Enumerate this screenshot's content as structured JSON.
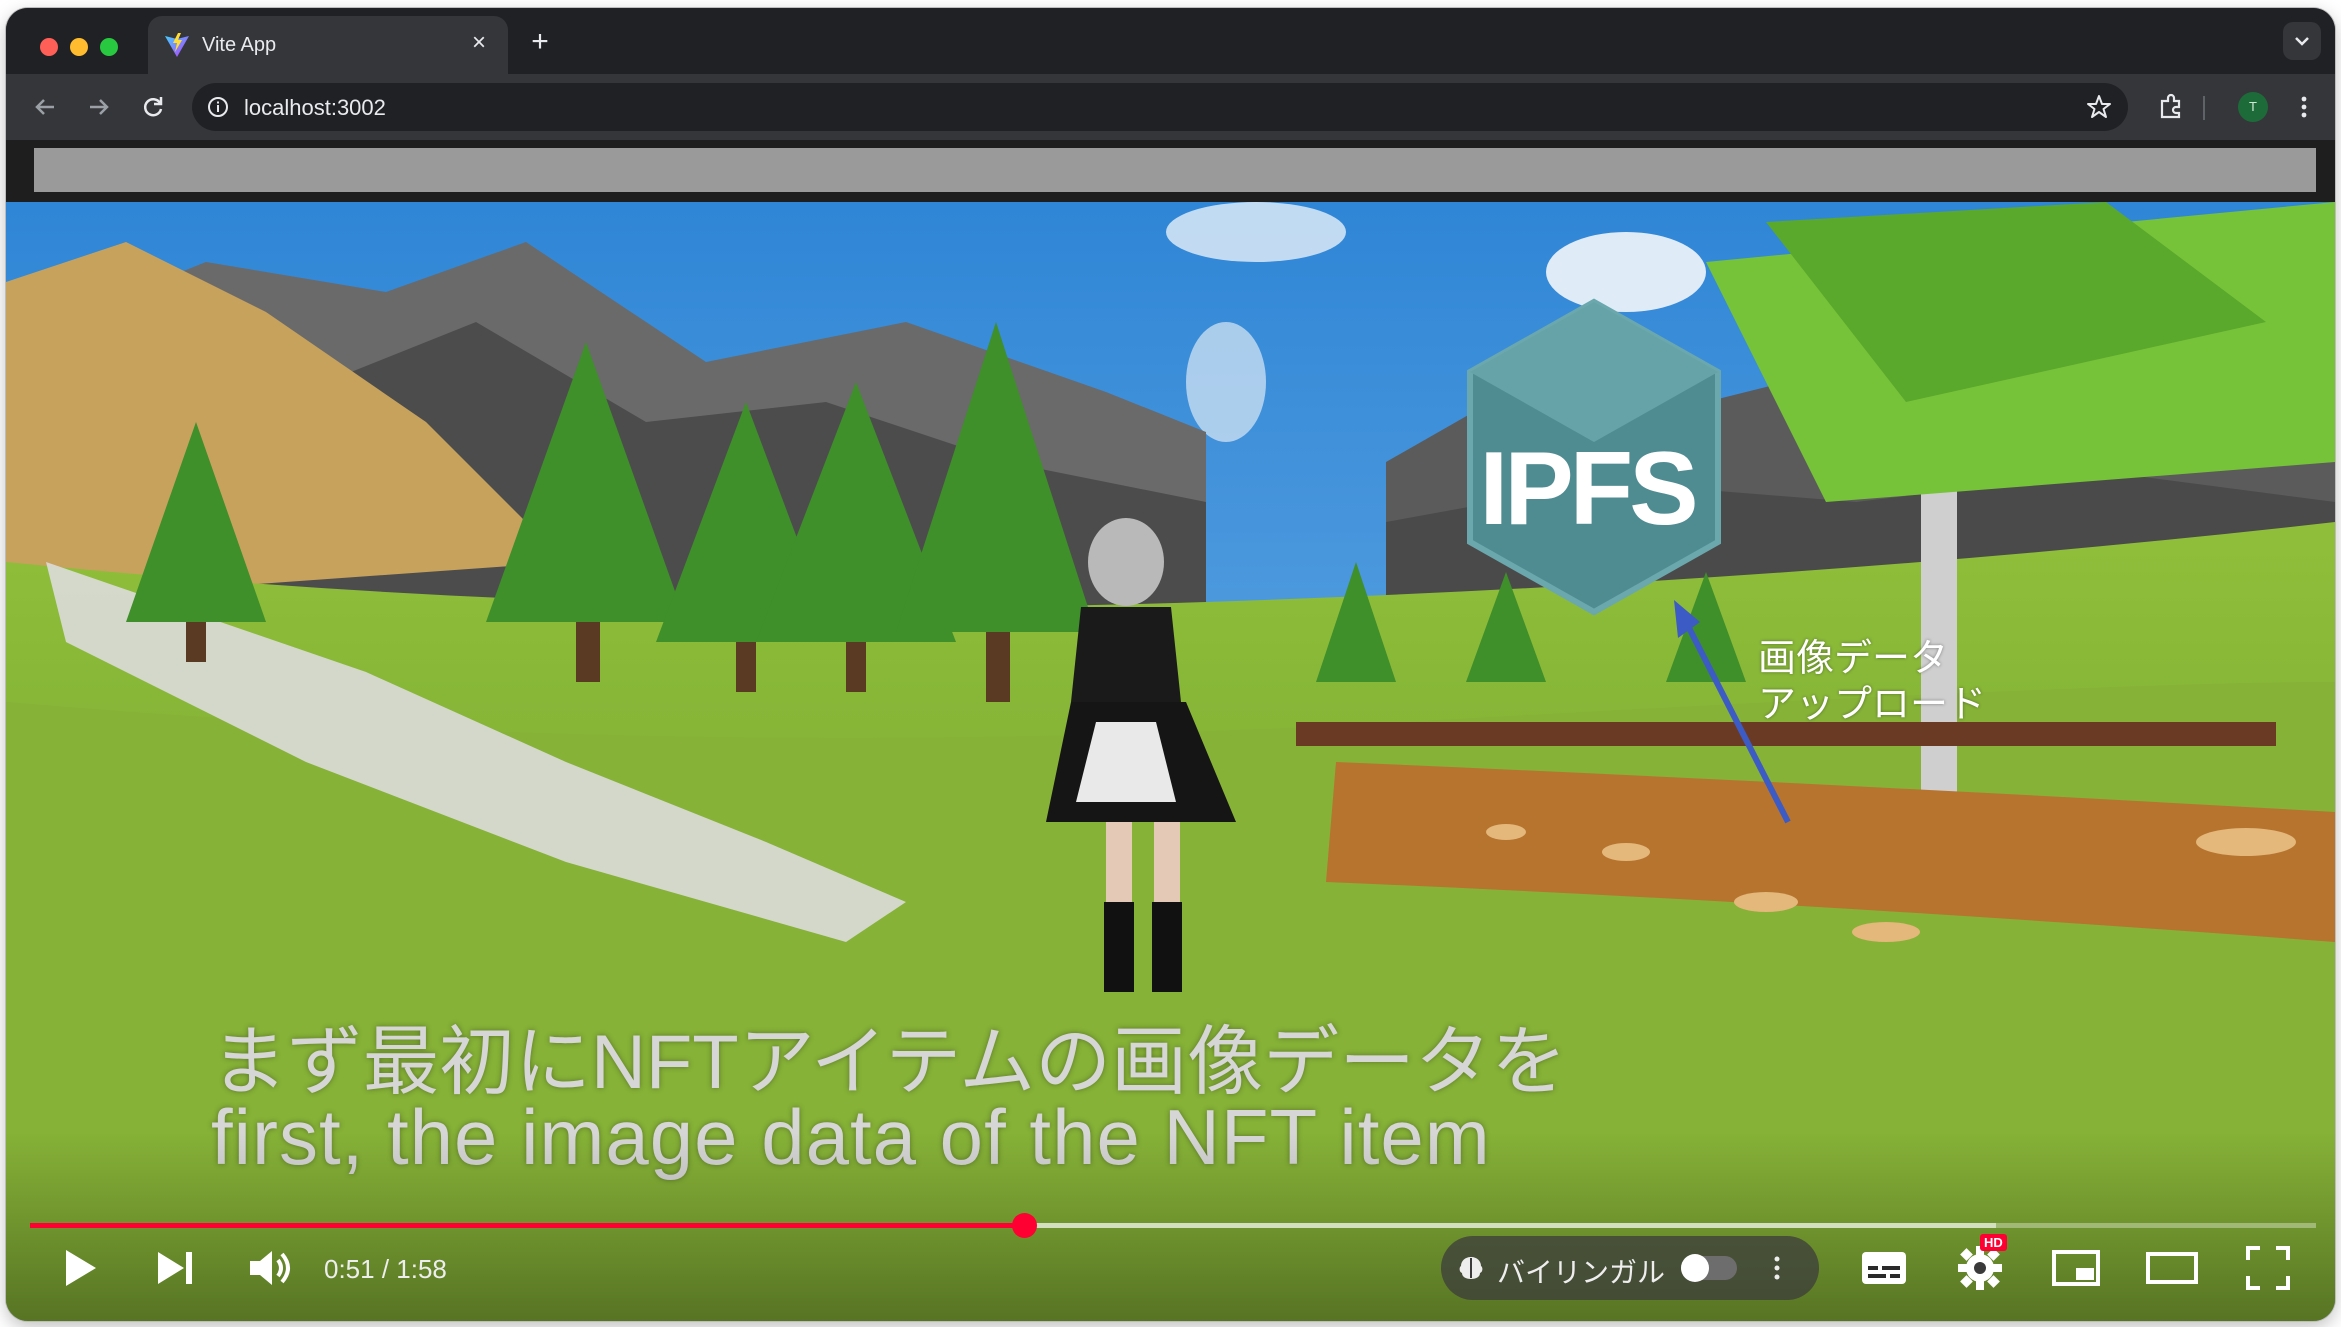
{
  "browser": {
    "tab": {
      "title": "Vite App",
      "close_glyph": "×"
    },
    "new_tab_glyph": "+",
    "address": {
      "url": "localhost:3002"
    },
    "profile_initial": "T"
  },
  "video": {
    "overlay_logo_text": "IPFS",
    "annotation": {
      "line1": "画像データ",
      "line2": "アップロード"
    },
    "caption": {
      "japanese": "まず最初にNFTアイテムの画像データを",
      "english": "first, the image data of the NFT item"
    }
  },
  "player": {
    "time_display": "0:51 / 1:58",
    "played_fraction": 0.435,
    "buffered_fraction": 0.86,
    "bilingual_label": "バイリンガル",
    "hd_badge": "HD",
    "colors": {
      "progress": "#ff0033"
    }
  }
}
